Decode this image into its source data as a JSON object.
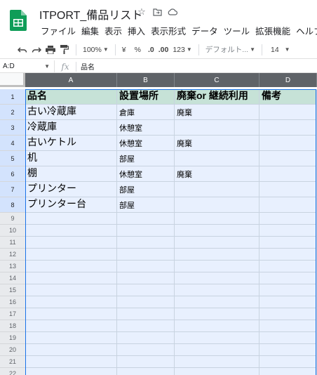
{
  "app": {
    "title": "ITPORT_備品リスト",
    "icons": [
      "star-icon",
      "move-to-folder-icon",
      "cloud-status-icon"
    ]
  },
  "menu": [
    "ファイル",
    "編集",
    "表示",
    "挿入",
    "表示形式",
    "データ",
    "ツール",
    "拡張機能",
    "ヘルプ"
  ],
  "toolbar": {
    "zoom": "100%",
    "currency": "¥",
    "percent": "%",
    "decimal_decrease": ".0",
    "decimal_increase": ".00",
    "more_formats": "123",
    "font": "デフォルト...",
    "font_size": "14"
  },
  "formula": {
    "name_box": "A:D",
    "fx": "fx",
    "value": "品名"
  },
  "columns": [
    "A",
    "B",
    "C",
    "D"
  ],
  "rows": [
    [
      "品名",
      "設置場所",
      "廃棄or 継続利用",
      "備考"
    ],
    [
      "古い冷蔵庫",
      "倉庫",
      "廃棄",
      ""
    ],
    [
      "冷蔵庫",
      "休憩室",
      "",
      ""
    ],
    [
      "古いケトル",
      "休憩室",
      "廃棄",
      ""
    ],
    [
      "机",
      "部屋",
      "",
      ""
    ],
    [
      "棚",
      "休憩室",
      "廃棄",
      ""
    ],
    [
      "プリンター",
      "部屋",
      "",
      ""
    ],
    [
      "プリンター台",
      "部屋",
      "",
      ""
    ],
    [
      "",
      "",
      "",
      ""
    ],
    [
      "",
      "",
      "",
      ""
    ],
    [
      "",
      "",
      "",
      ""
    ],
    [
      "",
      "",
      "",
      ""
    ],
    [
      "",
      "",
      "",
      ""
    ],
    [
      "",
      "",
      "",
      ""
    ],
    [
      "",
      "",
      "",
      ""
    ],
    [
      "",
      "",
      "",
      ""
    ],
    [
      "",
      "",
      "",
      ""
    ],
    [
      "",
      "",
      "",
      ""
    ],
    [
      "",
      "",
      "",
      ""
    ],
    [
      "",
      "",
      "",
      ""
    ],
    [
      "",
      "",
      "",
      ""
    ],
    [
      "",
      "",
      "",
      ""
    ]
  ],
  "row_numbers": [
    "1",
    "2",
    "3",
    "4",
    "5",
    "6",
    "7",
    "8",
    "9",
    "10",
    "11",
    "12",
    "13",
    "14",
    "15",
    "16",
    "17",
    "18",
    "19",
    "20",
    "21",
    "22"
  ],
  "colors": {
    "header_fill": "#c6e2d7",
    "selection_fill": "#e8f0fe",
    "selection_border": "#1a73e8",
    "logo_green": "#0f9d58"
  }
}
